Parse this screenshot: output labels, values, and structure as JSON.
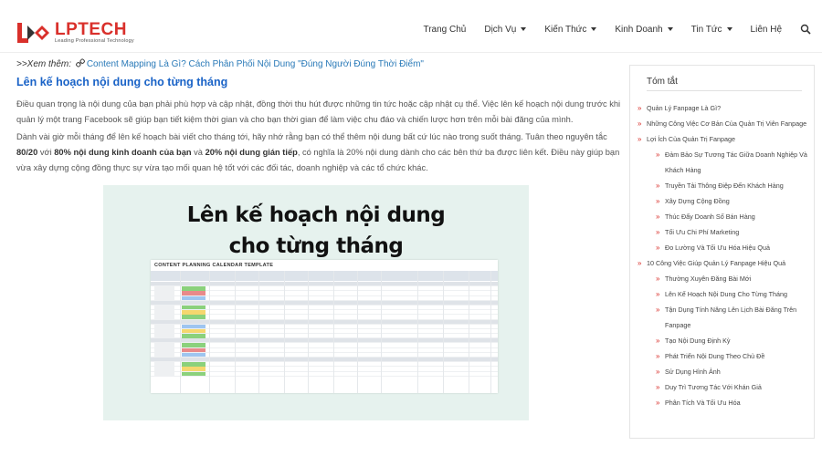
{
  "header": {
    "logo": {
      "brand": "LPTECH",
      "tagline": "Leading Professional Technology"
    },
    "nav": [
      {
        "label": "Trang Chủ",
        "dropdown": false
      },
      {
        "label": "Dịch Vụ",
        "dropdown": true
      },
      {
        "label": "Kiến Thức",
        "dropdown": true
      },
      {
        "label": "Kinh Doanh",
        "dropdown": true
      },
      {
        "label": "Tin Tức",
        "dropdown": true
      },
      {
        "label": "Liên Hệ",
        "dropdown": false
      }
    ],
    "search_icon": "search-icon"
  },
  "article": {
    "see_more_label": ">>Xem thêm: ",
    "see_more_link": "Content Mapping Là Gì? Cách Phân Phối Nội Dung \"Đúng Người Đúng Thời Điểm\"",
    "section_title": "Lên kế hoạch nội dung cho từng tháng",
    "para1": "Điều quan trọng là nội dung của bạn phải phù hợp và cập nhật, đồng thời thu hút được những tin tức hoặc cập nhật cụ thể. Việc lên kế hoạch nội dung trước khi quản lý một trang Facebook sẽ giúp bạn tiết kiệm thời gian và cho bạn thời gian để làm việc chu đáo và chiến lược hơn trên mỗi bài đăng của mình.",
    "para2": {
      "t1": "Dành vài giờ mỗi tháng để lên kế hoạch bài viết cho tháng tới, hãy nhớ rằng bạn có thể thêm nội dung bất cứ lúc nào trong suốt tháng. Tuân theo nguyên tắc ",
      "b1": "80/20",
      "t2": " với ",
      "b2": "80% nội dung kinh doanh của bạn",
      "t3": " và ",
      "b3": "20% nội dung gián tiếp",
      "t4": ", có nghĩa là 20% nội dung dành cho các bên thứ ba được liên kết. Điều này giúp bạn vừa xây dựng cộng đồng thực sự vừa tạo mối quan hệ tốt với các đối tác, doanh nghiệp và các tổ chức khác."
    },
    "illustration": {
      "line1": "Lên kế hoạch nội dung",
      "line2": "cho từng tháng",
      "sheet_title": "CONTENT PLANNING CALENDAR TEMPLATE"
    }
  },
  "sidebar": {
    "title": "Tóm tắt",
    "toc": [
      {
        "level": 0,
        "label": "Quản Lý Fanpage Là Gì?"
      },
      {
        "level": 0,
        "label": "Những Công Việc Cơ Bản Của Quản Trị Viên Fanpage"
      },
      {
        "level": 0,
        "label": "Lợi Ích Của Quản Trị Fanpage"
      },
      {
        "level": 1,
        "label": "Đảm Bảo Sự Tương Tác Giữa Doanh Nghiệp Và Khách Hàng"
      },
      {
        "level": 1,
        "label": "Truyền Tải Thông Điệp Đến Khách Hàng"
      },
      {
        "level": 1,
        "label": "Xây Dựng Cộng Đồng"
      },
      {
        "level": 1,
        "label": "Thúc Đẩy Doanh Số Bán Hàng"
      },
      {
        "level": 1,
        "label": "Tối Ưu Chi Phí Marketing"
      },
      {
        "level": 1,
        "label": "Đo Lường Và Tối Ưu Hóa Hiệu Quả"
      },
      {
        "level": 0,
        "label": "10 Công Việc Giúp Quản Lý Fanpage Hiệu Quả"
      },
      {
        "level": 1,
        "label": "Thường Xuyên Đăng Bài Mới"
      },
      {
        "level": 1,
        "label": "Lên Kế Hoạch Nội Dung Cho Từng Tháng"
      },
      {
        "level": 1,
        "label": "Tận Dụng Tính Năng Lên Lịch Bài Đăng Trên Fanpage"
      },
      {
        "level": 1,
        "label": "Tạo Nội Dung Định Kỳ"
      },
      {
        "level": 1,
        "label": "Phát Triển Nội Dung Theo Chủ Đề"
      },
      {
        "level": 1,
        "label": "Sử Dụng Hình Ảnh"
      },
      {
        "level": 1,
        "label": "Duy Trì Tương Tác Với Khán Giả"
      },
      {
        "level": 1,
        "label": "Phân Tích Và Tối Ưu Hóa"
      }
    ]
  },
  "colors": {
    "brand": "#d9302b",
    "link": "#2a7ab8",
    "heading": "#1a63c7",
    "illustration_bg": "#e6f2ee"
  }
}
